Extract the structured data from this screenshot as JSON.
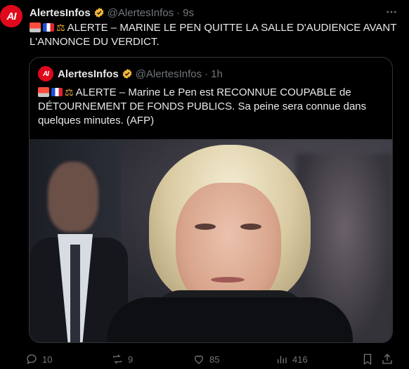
{
  "tweet": {
    "author_name": "AlertesInfos",
    "handle": "@AlertesInfos",
    "separator": "·",
    "time": "9s",
    "text": "ALERTE – MARINE LE PEN QUITTE LA SALLE D'AUDIENCE AVANT L'ANNONCE DU VERDICT."
  },
  "quote": {
    "author_name": "AlertesInfos",
    "handle": "@AlertesInfos",
    "separator": "·",
    "time": "1h",
    "text": "ALERTE – Marine Le Pen est RECONNUE COUPABLE de DÉTOURNEMENT DE FONDS PUBLICS. Sa peine sera connue dans quelques minutes. (AFP)"
  },
  "avatar_logo": "AI",
  "actions": {
    "replies": "10",
    "reposts": "9",
    "likes": "85",
    "views": "416"
  },
  "colors": {
    "brand": "#e0081c",
    "verified": "#f2b63c",
    "muted": "#71767b",
    "border": "#2f3336"
  },
  "icons": [
    "siren-emoji",
    "france-flag-emoji",
    "scales-emoji",
    "verified-badge-icon",
    "more-icon",
    "reply-icon",
    "repost-icon",
    "like-icon",
    "views-icon",
    "bookmark-icon",
    "share-icon"
  ]
}
